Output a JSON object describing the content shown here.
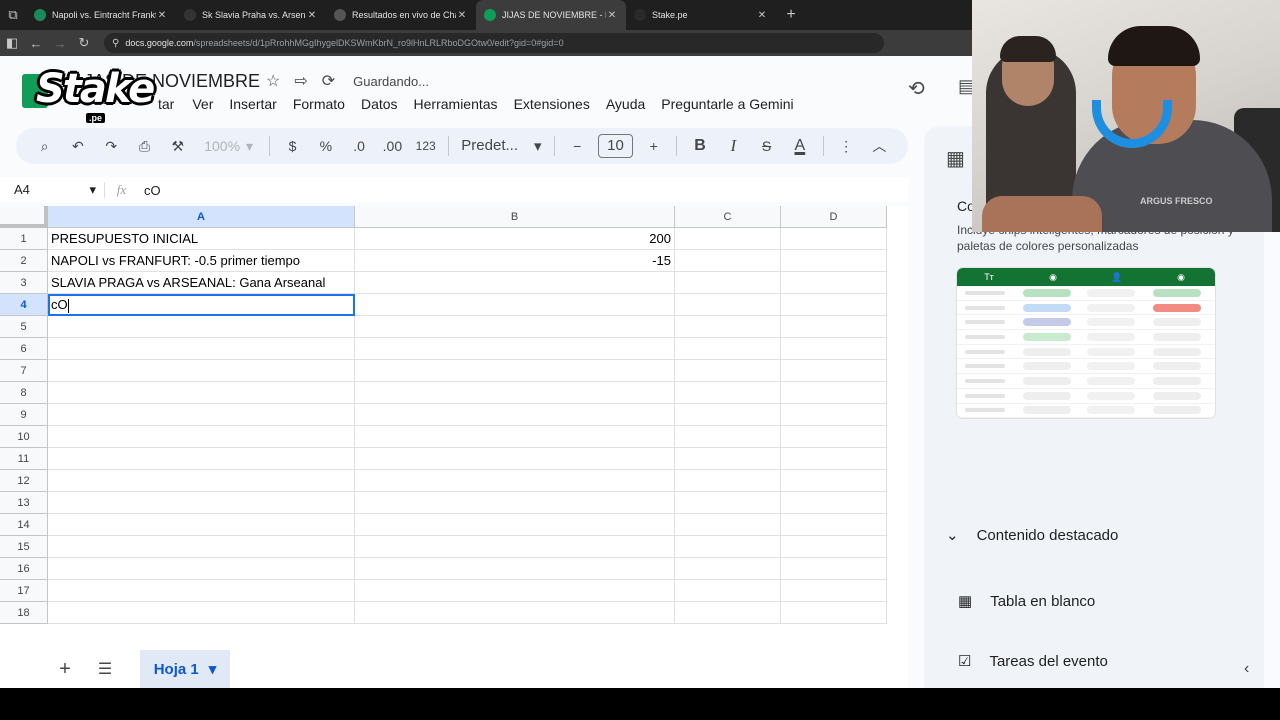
{
  "browser": {
    "tabs": [
      {
        "title": "Napoli vs. Eintracht Frankfu",
        "close": "✕",
        "active": false,
        "color": "#1a8a5a"
      },
      {
        "title": "Sk Slavia Praha vs. Arsenal | Dis",
        "close": "✕",
        "active": false,
        "color": "#333"
      },
      {
        "title": "Resultados en vivo de Champio",
        "close": "✕",
        "active": false,
        "color": "#555"
      },
      {
        "title": "JIJAS DE NOVIEMBRE - Hojas de",
        "close": "✕",
        "active": true,
        "color": "#0f9d58"
      },
      {
        "title": "Stake.pe",
        "close": "✕",
        "active": false,
        "color": "#2a2a2a"
      }
    ],
    "new_tab": "+",
    "url_host": "docs.google.com",
    "url_path": "/spreadsheets/d/1pRrohhMGgIhygelDKSWmKbrN_ro9lHnLRLRboDGOtw0/edit?gid=0#gid=0"
  },
  "overlay": {
    "brand": "Stake",
    "brand_suffix": ".pe"
  },
  "doc": {
    "title": "JAS DE NOVIEMBRE",
    "status": "Guardando..."
  },
  "menu": {
    "partial": "tar",
    "items": [
      "Ver",
      "Insertar",
      "Formato",
      "Datos",
      "Herramientas",
      "Extensiones",
      "Ayuda",
      "Preguntarle a Gemini"
    ]
  },
  "toolbar": {
    "zoom": "100%",
    "currency": "$",
    "percent": "%",
    "dec_less": ".0",
    "dec_more": ".00",
    "number_fmt": "123",
    "font": "Predet...",
    "font_size": "10",
    "minus": "−",
    "plus": "+",
    "bold": "B",
    "italic": "I",
    "strike": "S",
    "text_color": "A"
  },
  "formula_bar": {
    "cell_ref": "A4",
    "fx": "fx",
    "content": "cO"
  },
  "sheet": {
    "columns": [
      "A",
      "B",
      "C",
      "D"
    ],
    "rows": [
      {
        "num": "1",
        "a": "PRESUPUESTO INICIAL",
        "b": "200"
      },
      {
        "num": "2",
        "a": "NAPOLI vs FRANFURT: -0.5 primer tiempo",
        "b": "-15"
      },
      {
        "num": "3",
        "a": "SLAVIA PRAGA vs ARSEANAL: Gana Arseanal",
        "b": ""
      },
      {
        "num": "4",
        "a": "cO",
        "b": ""
      },
      {
        "num": "5",
        "a": "",
        "b": ""
      },
      {
        "num": "6",
        "a": "",
        "b": ""
      },
      {
        "num": "7",
        "a": "",
        "b": ""
      },
      {
        "num": "8",
        "a": "",
        "b": ""
      },
      {
        "num": "9",
        "a": "",
        "b": ""
      },
      {
        "num": "10",
        "a": "",
        "b": ""
      },
      {
        "num": "11",
        "a": "",
        "b": ""
      },
      {
        "num": "12",
        "a": "",
        "b": ""
      },
      {
        "num": "13",
        "a": "",
        "b": ""
      },
      {
        "num": "14",
        "a": "",
        "b": ""
      },
      {
        "num": "15",
        "a": "",
        "b": ""
      },
      {
        "num": "16",
        "a": "",
        "b": ""
      },
      {
        "num": "17",
        "a": "",
        "b": ""
      },
      {
        "num": "18",
        "a": "",
        "b": ""
      }
    ],
    "active_row": "4",
    "active_col": "A",
    "tab_name": "Hoja 1"
  },
  "side_panel": {
    "heading": "Co",
    "description": "Incluye chips inteligentes, marcadores de posición y paletas de colores personalizadas",
    "section": "Contenido destacado",
    "items": [
      "Tabla en blanco",
      "Tareas del evento"
    ],
    "preview_header": [
      "Tт",
      "◉",
      "👤",
      "◉"
    ]
  },
  "webcam": {
    "shirt_text": "ARGUS FRESCO"
  }
}
